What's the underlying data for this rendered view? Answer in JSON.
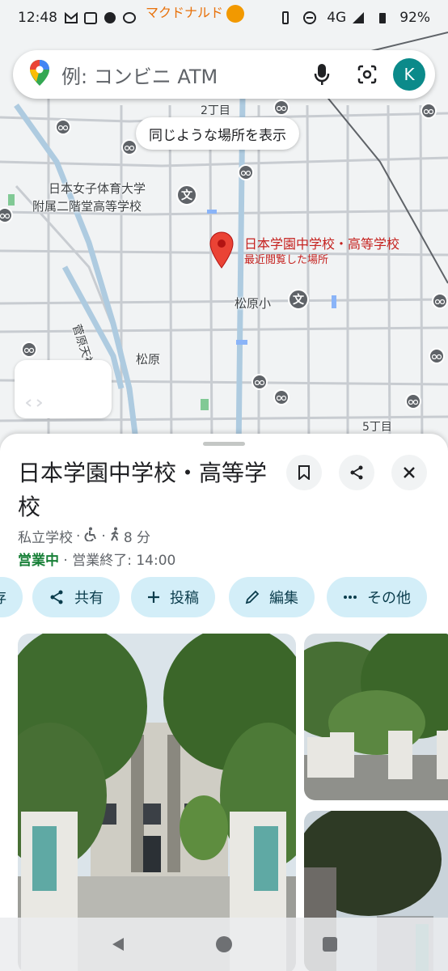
{
  "status_bar": {
    "time": "12:48",
    "network": "4G",
    "battery": "92%",
    "map_overlay_text": "マクドナルド"
  },
  "search": {
    "placeholder": "例: コンビニ ATM",
    "avatar_letter": "K"
  },
  "map": {
    "similar_places_chip": "同じような場所を表示",
    "labels": {
      "chome_2": "2丁目",
      "school_name_line1": "日本女子体育大学",
      "school_name_line2": "附属二階堂高等学校",
      "matsubara_elem": "松原小",
      "road_name": "菅原天神通り",
      "district": "松原",
      "chome_5": "5丁目"
    },
    "selected_pin": {
      "name": "日本学園中学校・高等学校",
      "subtitle": "最近閲覧した場所"
    },
    "school_glyph": "文"
  },
  "place": {
    "title": "日本学園中学校・高等学校",
    "category": "私立学校",
    "walk_time": "8 分",
    "open_status": "営業中",
    "hours_text": "· 営業終了: 14:00"
  },
  "actions": [
    {
      "label": "存"
    },
    {
      "label": "共有"
    },
    {
      "label": "投稿"
    },
    {
      "label": "編集"
    },
    {
      "label": "その他"
    }
  ],
  "colors": {
    "accent_teal": "#0b8a8a",
    "pin_red": "#ea4335",
    "open_green": "#188038",
    "chip_bg": "#d3eef8"
  }
}
